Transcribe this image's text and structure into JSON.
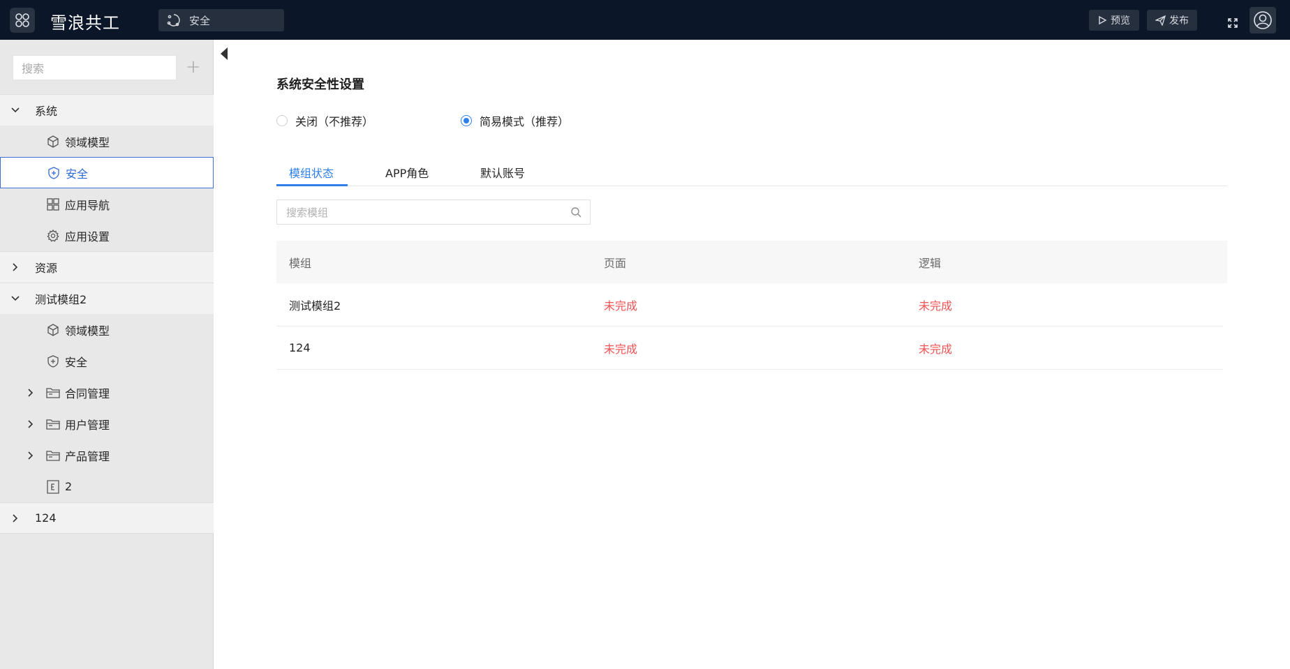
{
  "header": {
    "app_title": "雪浪共工",
    "breadcrumb": "安全",
    "preview_label": "预览",
    "publish_label": "发布"
  },
  "sidebar": {
    "search_placeholder": "搜索",
    "add_symbol": "+",
    "groups": [
      {
        "label": "系统",
        "expanded": true,
        "children": [
          {
            "label": "领域模型",
            "icon": "cube-icon"
          },
          {
            "label": "安全",
            "icon": "shield-plus-icon",
            "selected": true
          },
          {
            "label": "应用导航",
            "icon": "grid-icon"
          },
          {
            "label": "应用设置",
            "icon": "gear-icon"
          }
        ]
      },
      {
        "label": "资源",
        "expanded": false,
        "children": []
      },
      {
        "label": "测试模组2",
        "expanded": true,
        "children": [
          {
            "label": "领域模型",
            "icon": "cube-icon"
          },
          {
            "label": "安全",
            "icon": "shield-plus-icon"
          },
          {
            "label": "合同管理",
            "icon": "folder-icon",
            "expandable": true
          },
          {
            "label": "用户管理",
            "icon": "folder-icon",
            "expandable": true
          },
          {
            "label": "产品管理",
            "icon": "folder-icon",
            "expandable": true
          },
          {
            "label": "2",
            "icon": "entity-e-icon"
          }
        ]
      },
      {
        "label": "124",
        "expanded": false,
        "children": []
      }
    ]
  },
  "main": {
    "section_title": "系统安全性设置",
    "radio_off_label": "关闭（不推荐）",
    "radio_on_label": "简易模式（推荐）",
    "selected_mode": "简易模式（推荐）",
    "tabs": [
      "模组状态",
      "APP角色",
      "默认账号"
    ],
    "active_tab": "模组状态",
    "table_search_placeholder": "搜索模组",
    "table": {
      "columns": [
        "模组",
        "页面",
        "逻辑"
      ],
      "rows": [
        [
          "测试模组2",
          "未完成",
          "未完成"
        ],
        [
          "124",
          "未完成",
          "未完成"
        ]
      ]
    }
  },
  "colors": {
    "topbar": "#0b1628",
    "accent": "#2f80ed",
    "incomplete": "#f05252",
    "selected_border": "#3d6fd6"
  }
}
